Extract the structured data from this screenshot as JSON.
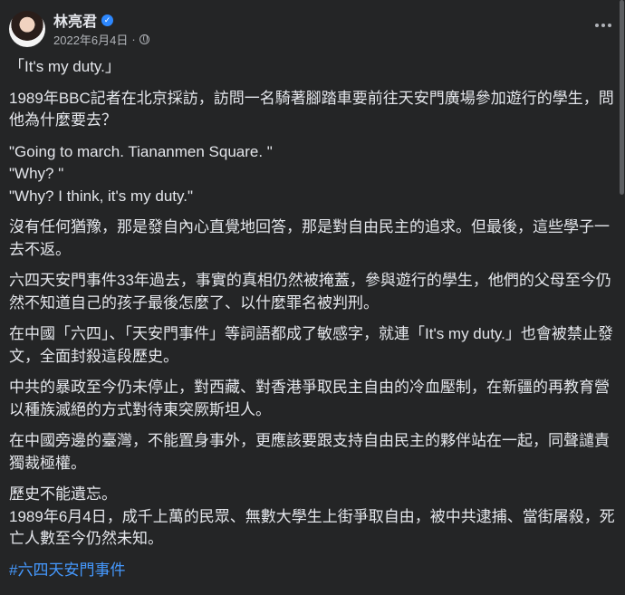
{
  "author": {
    "name": "林亮君",
    "date": "2022年6月4日",
    "separator": "·"
  },
  "icons": {
    "verified": "verified-badge-icon",
    "audience": "globe-icon",
    "menu": "more-options-icon"
  },
  "colors": {
    "background": "#242526",
    "text": "#e4e6eb",
    "secondary_text": "#b0b3b8",
    "link": "#4599ff",
    "verified": "#2d88ff"
  },
  "post": {
    "paragraphs": [
      "「It's my duty.」",
      "1989年BBC記者在北京採訪，訪問一名騎著腳踏車要前往天安門廣場參加遊行的學生，問他為什麼要去？",
      "\"Going to march. Tiananmen Square. \"\n\"Why? \"\n\"Why? I think, it's my duty.\"",
      "沒有任何猶豫，那是發自內心直覺地回答，那是對自由民主的追求。但最後，這些學子一去不返。",
      "六四天安門事件33年過去，事實的真相仍然被掩蓋，參與遊行的學生，他們的父母至今仍然不知道自己的孩子最後怎麼了、以什麼罪名被判刑。",
      "在中國「六四」、「天安門事件」等詞語都成了敏感字，就連「It's my duty.」也會被禁止發文，全面封殺這段歷史。",
      "中共的暴政至今仍未停止，對西藏、對香港爭取民主自由的冷血壓制，在新疆的再教育營以種族滅絕的方式對待東突厥斯坦人。",
      "在中國旁邊的臺灣，不能置身事外，更應該要跟支持自由民主的夥伴站在一起，同聲譴責獨裁極權。",
      "歷史不能遺忘。\n1989年6月4日，成千上萬的民眾、無數大學生上街爭取自由，被中共逮捕、當街屠殺，死亡人數至今仍然未知。"
    ],
    "hashtag": "#六四天安門事件"
  }
}
